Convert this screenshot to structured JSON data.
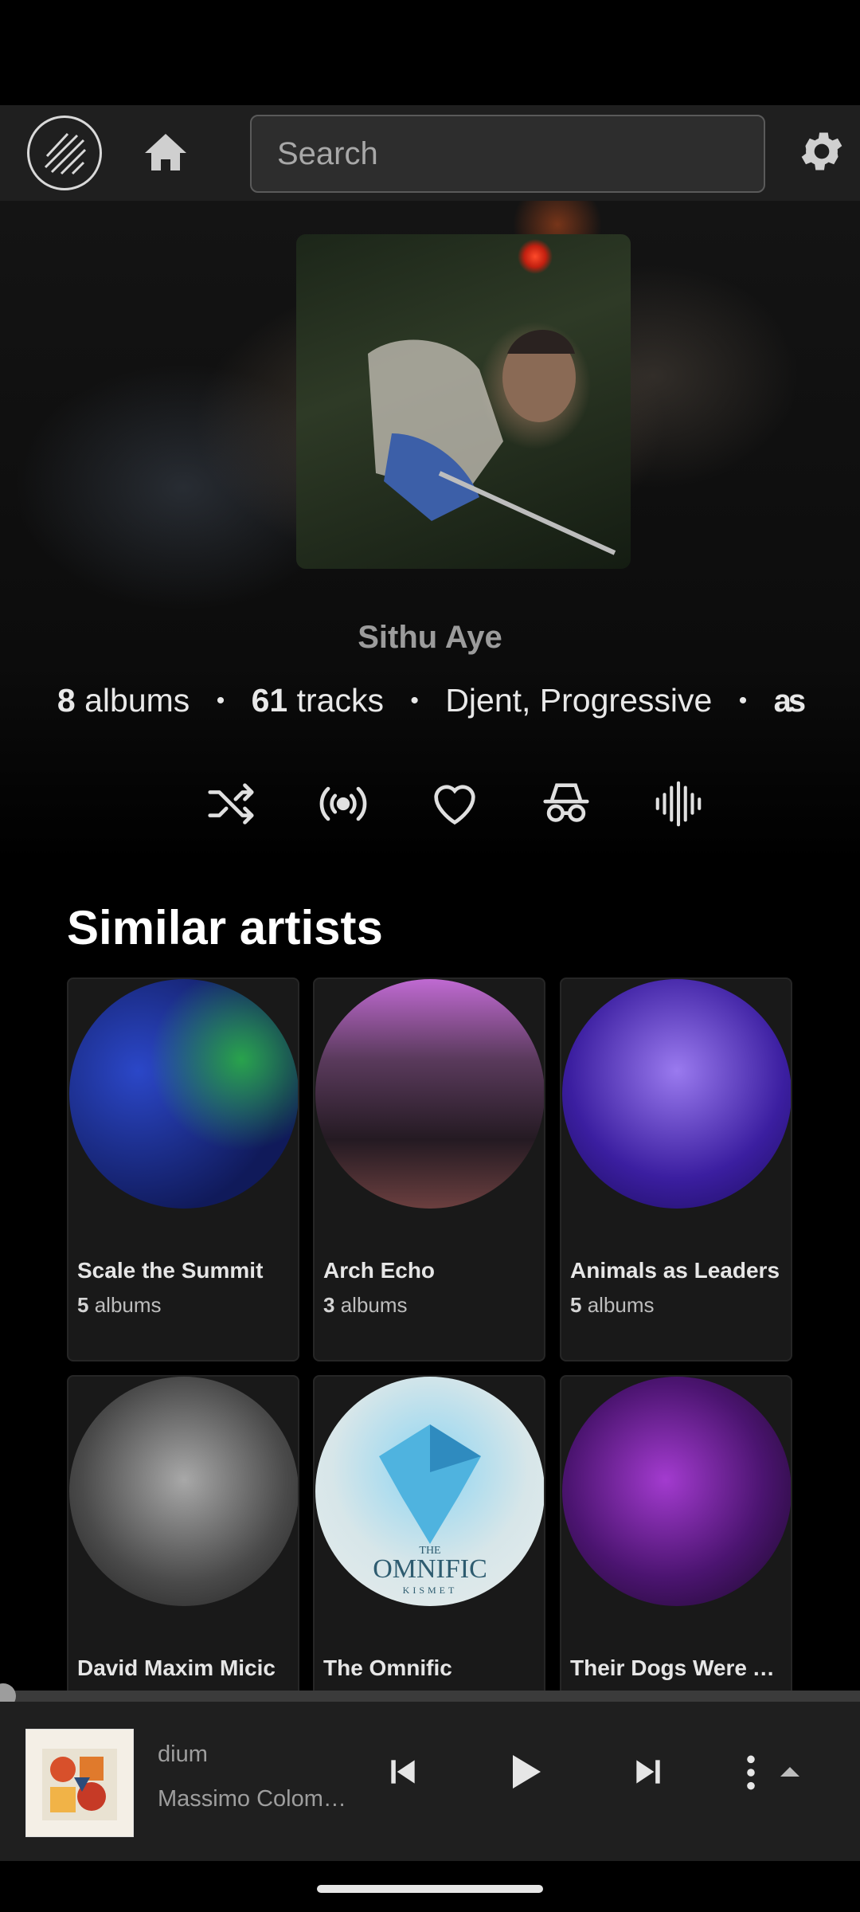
{
  "header": {
    "search_placeholder": "Search",
    "logo_icon": "vinyl-logo-icon",
    "home_icon": "home-icon",
    "settings_icon": "gear-icon"
  },
  "artist": {
    "name": "Sithu Aye",
    "albums_count": "8",
    "albums_label": "albums",
    "tracks_count": "61",
    "tracks_label": "tracks",
    "genres": "Djent, Progressive",
    "separator": "•",
    "lastfm_label": "as"
  },
  "actions": [
    {
      "icon": "shuffle-icon"
    },
    {
      "icon": "radio-icon"
    },
    {
      "icon": "heart-icon"
    },
    {
      "icon": "incognito-icon"
    },
    {
      "icon": "waveform-icon"
    }
  ],
  "similar": {
    "title": "Similar artists",
    "albums_label": "albums",
    "artists": [
      {
        "name": "Scale the Summit",
        "albums": "5"
      },
      {
        "name": "Arch Echo",
        "albums": "3"
      },
      {
        "name": "Animals as Leaders",
        "albums": "5"
      },
      {
        "name": "David Maxim Micic",
        "albums": ""
      },
      {
        "name": "The Omnific",
        "albums": ""
      },
      {
        "name": "Their Dogs Were A…",
        "albums": ""
      }
    ],
    "omnific_logo_line1": "THE",
    "omnific_logo_line2": "OMNIFIC",
    "omnific_logo_line3": "KISMET"
  },
  "player": {
    "track_title": "dium",
    "track_artist": "Massimo Colom…",
    "progress": 0.0,
    "colors": {
      "accent": "#9d9d9d",
      "background": "#1f1f1f"
    }
  }
}
